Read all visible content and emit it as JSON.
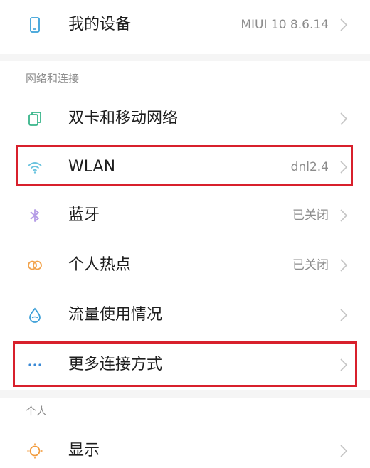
{
  "rows": {
    "my_device": {
      "title": "我的设备",
      "value": "MIUI 10 8.6.14",
      "icon": "phone-icon"
    },
    "dual_sim": {
      "title": "双卡和移动网络",
      "icon": "sim-cards-icon"
    },
    "wlan": {
      "title": "WLAN",
      "value": "dnl2.4",
      "icon": "wifi-icon"
    },
    "bluetooth": {
      "title": "蓝牙",
      "value": "已关闭",
      "icon": "bluetooth-icon"
    },
    "hotspot": {
      "title": "个人热点",
      "value": "已关闭",
      "icon": "hotspot-icon"
    },
    "data_usage": {
      "title": "流量使用情况",
      "icon": "droplet-icon"
    },
    "more_connections": {
      "title": "更多连接方式",
      "icon": "more-dots-icon"
    },
    "display": {
      "title": "显示",
      "icon": "sun-icon"
    }
  },
  "sections": {
    "network": "网络和连接",
    "personal": "个人"
  },
  "colors": {
    "highlight": "#d8202c",
    "wifi_icon": "#6cc4df",
    "bluetooth_icon": "#b49be6",
    "hotspot_icon": "#f2a24a",
    "droplet_icon": "#3ea0d8",
    "dots_icon": "#3a8ad6",
    "sun_icon": "#f29a3a",
    "sim_icon": "#38b58a",
    "phone_icon": "#3aa0d8"
  }
}
